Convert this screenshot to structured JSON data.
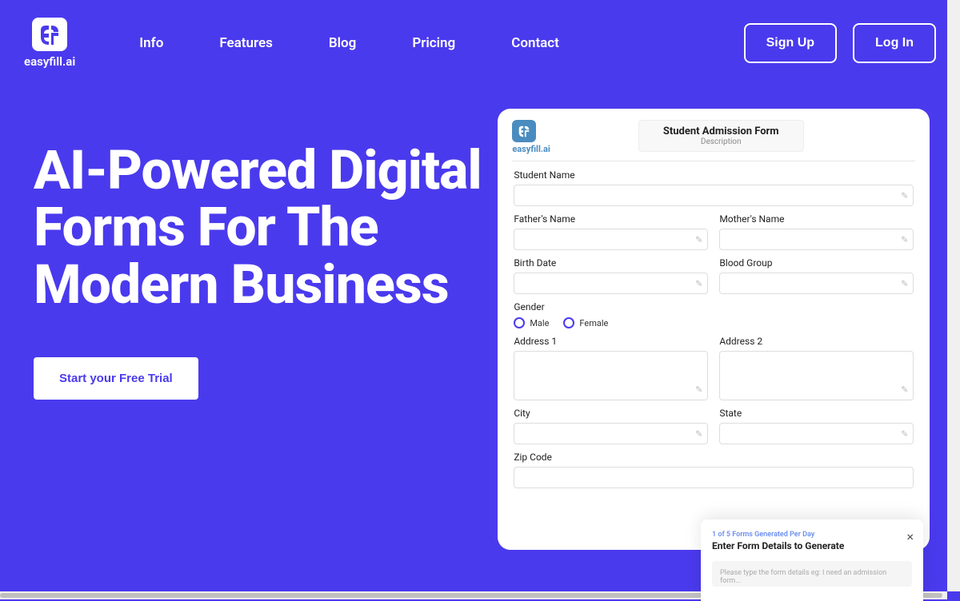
{
  "brand": {
    "name": "easyfill.ai"
  },
  "nav": {
    "items": [
      {
        "label": "Info"
      },
      {
        "label": "Features"
      },
      {
        "label": "Blog"
      },
      {
        "label": "Pricing"
      },
      {
        "label": "Contact"
      }
    ]
  },
  "auth": {
    "signup": "Sign Up",
    "login": "Log In"
  },
  "hero": {
    "title": "AI-Powered Digital Forms For The Modern Business",
    "cta": "Start your Free Trial"
  },
  "form_card": {
    "brand": "easyfill.ai",
    "title": "Student Admission Form",
    "desc": "Description",
    "fields": {
      "student_name": "Student Name",
      "father_name": "Father's Name",
      "mother_name": "Mother's Name",
      "birth_date": "Birth Date",
      "blood_group": "Blood Group",
      "gender": "Gender",
      "male": "Male",
      "female": "Female",
      "address1": "Address 1",
      "address2": "Address 2",
      "city": "City",
      "state": "State",
      "zip": "Zip Code"
    }
  },
  "chat": {
    "quota": "1 of 5 Forms Generated Per Day",
    "title": "Enter Form Details to Generate",
    "placeholder": "Please type the form details eg: I need an admission form..."
  }
}
